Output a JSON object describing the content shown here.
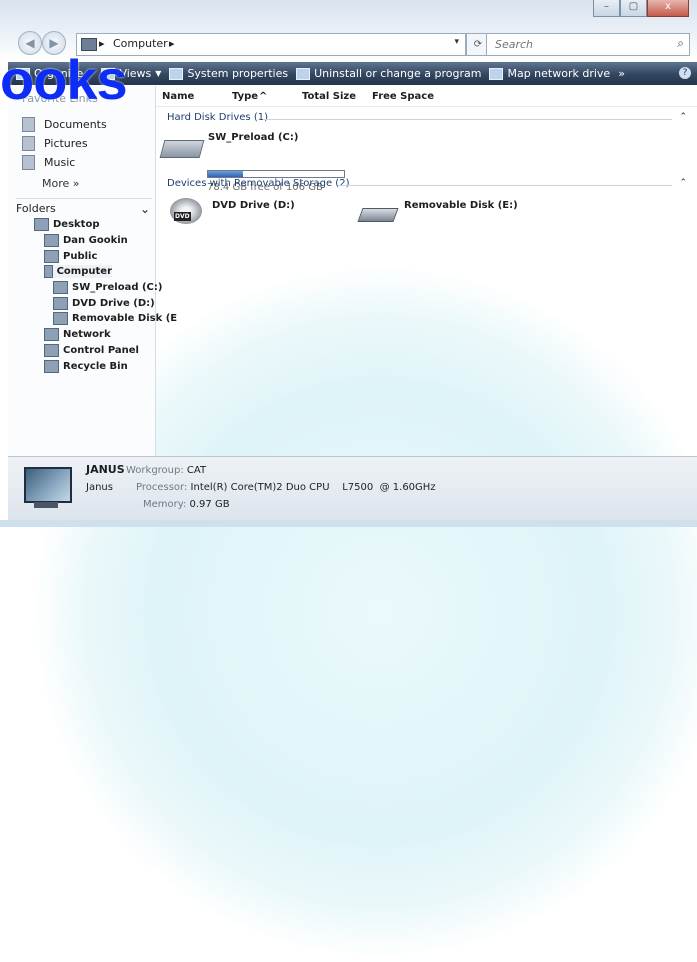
{
  "window": {
    "caption_buttons": [
      "–",
      "▢",
      "x"
    ]
  },
  "address": {
    "separator": "▸",
    "segment": "Computer",
    "trailing_arrow": "▸",
    "dropdown": "▾",
    "refresh_icon": "⟳",
    "search_placeholder": "Search",
    "search_icon": "⌕"
  },
  "watermark": {
    "text": "ooks"
  },
  "toolbar": {
    "items": [
      "Organize",
      "Views",
      "System properties",
      "Uninstall or change a program",
      "Map network drive"
    ],
    "overflow": "»",
    "help": "?"
  },
  "columns": [
    "Name",
    "Type",
    "Total Size",
    "Free Space"
  ],
  "nav": {
    "favorites_title": "Favorite Links",
    "favorites": [
      "Documents",
      "Pictures",
      "Music"
    ],
    "more": "More »",
    "folders_label": "Folders",
    "folders_chevron": "⌄",
    "tree": [
      "Desktop",
      "Dan Gookin",
      "Public",
      "Computer",
      "SW_Preload (C:)",
      "DVD Drive (D:)",
      "Removable Disk (E",
      "Network",
      "Control Panel",
      "Recycle Bin"
    ]
  },
  "content": {
    "group1": "Hard Disk Drives (1)",
    "group2": "Devices with Removable Storage (2)",
    "collapse_icon": "⌃",
    "c_drive": {
      "name": "SW_Preload (C:)",
      "free_text": "78.4 GB free of 106 GB",
      "used_fraction": 0.26
    },
    "d_drive": {
      "name": "DVD Drive (D:)",
      "badge": "DVD"
    },
    "e_drive": {
      "name": "Removable Disk (E:)"
    }
  },
  "details": {
    "computer_name": "JANUS",
    "workgroup_label": "Workgroup:",
    "workgroup": "CAT",
    "sub_name": "Janus",
    "processor_label": "Processor:",
    "processor": "Intel(R) Core(TM)2 Duo CPU    L7500  @ 1.60GHz",
    "memory_label": "Memory:",
    "memory": "0.97 GB"
  },
  "colors": {
    "toolbar": "#33465f",
    "bar_fill": "#2e62b2",
    "watermark": "#0d2cf5"
  }
}
